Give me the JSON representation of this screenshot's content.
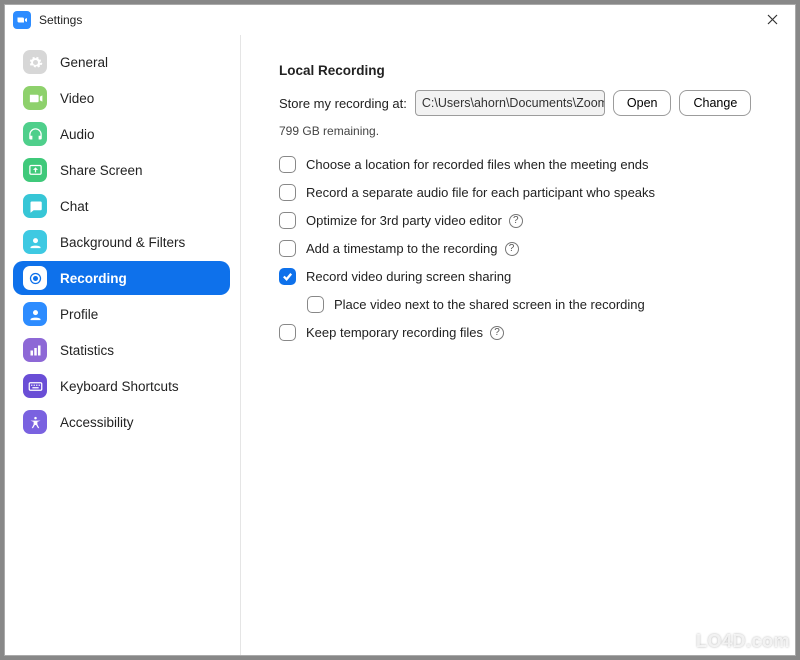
{
  "window": {
    "title": "Settings"
  },
  "sidebar": {
    "items": [
      {
        "label": "General"
      },
      {
        "label": "Video"
      },
      {
        "label": "Audio"
      },
      {
        "label": "Share Screen"
      },
      {
        "label": "Chat"
      },
      {
        "label": "Background & Filters"
      },
      {
        "label": "Recording"
      },
      {
        "label": "Profile"
      },
      {
        "label": "Statistics"
      },
      {
        "label": "Keyboard Shortcuts"
      },
      {
        "label": "Accessibility"
      }
    ]
  },
  "main": {
    "section_title": "Local Recording",
    "store_label": "Store my recording at:",
    "path_value": "C:\\Users\\ahorn\\Documents\\Zoom",
    "open_btn": "Open",
    "change_btn": "Change",
    "remaining": "799 GB remaining.",
    "options": [
      {
        "label": "Choose a location for recorded files when the meeting ends",
        "checked": false,
        "help": false
      },
      {
        "label": "Record a separate audio file for each participant who speaks",
        "checked": false,
        "help": false
      },
      {
        "label": "Optimize for 3rd party video editor",
        "checked": false,
        "help": true
      },
      {
        "label": "Add a timestamp to the recording",
        "checked": false,
        "help": true
      },
      {
        "label": "Record video during screen sharing",
        "checked": true,
        "help": false
      },
      {
        "label": "Place video next to the shared screen in the recording",
        "checked": false,
        "help": false,
        "indent": true
      },
      {
        "label": "Keep temporary recording files",
        "checked": false,
        "help": true
      }
    ]
  },
  "watermark": "LO4D.com"
}
